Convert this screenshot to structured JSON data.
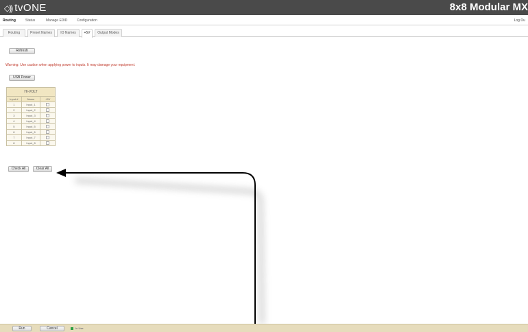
{
  "header": {
    "logo_text": "tvONE",
    "logo_mark": "◇))",
    "product": "8x8 Modular MX"
  },
  "main_nav": {
    "items": [
      "Routing",
      "Status",
      "Manage EDID",
      "Configuration"
    ],
    "active": "Routing",
    "logout": "Log Ou"
  },
  "sub_nav": {
    "tabs": [
      "Routing",
      "Preset Names",
      "IO Names",
      "+5V",
      "Output Modes"
    ],
    "active": "+5V"
  },
  "content": {
    "refresh_label": "Refresh",
    "warning": "Warning: Use caution when applying power to inputs. It may damage your equipment.",
    "usb_power_label": "USB Power",
    "table": {
      "title": "HI-VOLT",
      "columns": [
        "Input #",
        "Name",
        "+5V"
      ],
      "rows": [
        {
          "input": "1",
          "name": "Input_1",
          "checked": false
        },
        {
          "input": "2",
          "name": "Input_2",
          "checked": false
        },
        {
          "input": "3",
          "name": "Input_3",
          "checked": false
        },
        {
          "input": "4",
          "name": "Input_4",
          "checked": false
        },
        {
          "input": "5",
          "name": "Input_5",
          "checked": false
        },
        {
          "input": "6",
          "name": "Input_6",
          "checked": false
        },
        {
          "input": "7",
          "name": "Input_7",
          "checked": false
        },
        {
          "input": "8",
          "name": "Input_8",
          "checked": false
        }
      ]
    },
    "check_all_label": "Check All",
    "clear_all_label": "Clear All"
  },
  "footer": {
    "run_label": "Run",
    "cancel_label": "Cancel",
    "connection_status": "In Use",
    "status_color": "#2ea043"
  }
}
